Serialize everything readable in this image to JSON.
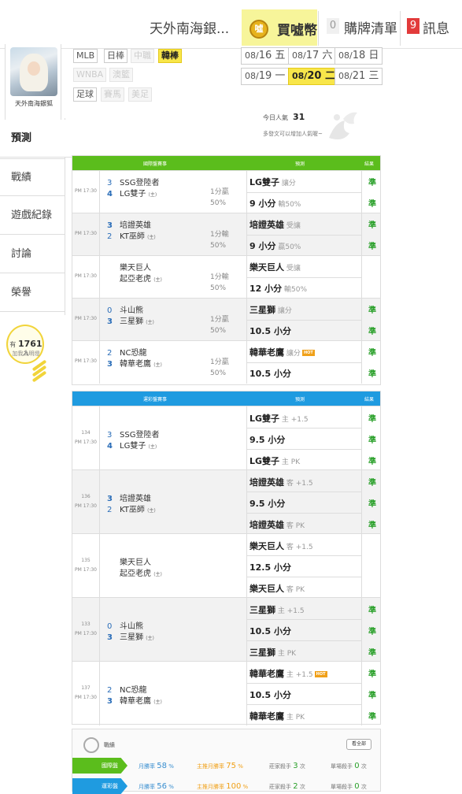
{
  "header": {
    "user_name": "天外南海銀...",
    "coin_label": "買噓幣",
    "cart_count": "0",
    "cart_label": "購牌清單",
    "msg_count": "9",
    "msg_label": "訊息"
  },
  "profile": {
    "name": "天外南海銀狐"
  },
  "sidebar": {
    "items": [
      {
        "label": "預測",
        "active": true
      },
      {
        "label": "戰績"
      },
      {
        "label": "遊戲紀錄"
      },
      {
        "label": "討論"
      },
      {
        "label": "榮譽"
      }
    ],
    "fans_prefix": "有",
    "fans_count": "1761",
    "fans_suffix": "人",
    "fans_sub": "加我為明燈"
  },
  "categories": [
    {
      "label": "MLB",
      "state": "normal"
    },
    {
      "label": "日棒",
      "state": "normal"
    },
    {
      "label": "中職",
      "state": "disabled"
    },
    {
      "label": "韓棒",
      "state": "active"
    },
    {
      "label": "WNBA",
      "state": "disabled"
    },
    {
      "label": "澳籃",
      "state": "disabled"
    },
    {
      "label": "足球",
      "state": "normal"
    },
    {
      "label": "賽馬",
      "state": "disabled"
    },
    {
      "label": "美足",
      "state": "disabled"
    }
  ],
  "dates": [
    {
      "md": "08/",
      "day": "16",
      "wd": "五"
    },
    {
      "md": "08/",
      "day": "17",
      "wd": "六"
    },
    {
      "md": "08/",
      "day": "18",
      "wd": "日"
    },
    {
      "md": "08/",
      "day": "19",
      "wd": "一"
    },
    {
      "md": "08/",
      "day": "20",
      "wd": "二",
      "active": true
    },
    {
      "md": "08/",
      "day": "21",
      "wd": "三"
    }
  ],
  "popularity": {
    "label": "今日人氣",
    "value": "31",
    "tip": "多發文可以增加人氣喔~"
  },
  "intl_table": {
    "headers": {
      "game": "國際盤賽事",
      "pred": "預測",
      "result": "結果"
    },
    "color": "#5bbd1c",
    "games": [
      {
        "time": "PM 17:30",
        "away_score": "3",
        "away": "SSG登陸者",
        "home_score": "4",
        "home": "LG雙子",
        "home_tag": "(主)",
        "handicap": "1分贏",
        "pct": "50%",
        "preds": [
          {
            "text": "LG雙子",
            "note": "讓分",
            "res": "準"
          },
          {
            "text": "9 小分",
            "note": "輸50%",
            "res": "準"
          }
        ]
      },
      {
        "time": "PM 17:30",
        "away_score": "3",
        "away": "培證英雄",
        "home_score": "2",
        "home": "KT巫師",
        "home_tag": "(主)",
        "handicap": "1分輸",
        "pct": "50%",
        "preds": [
          {
            "text": "培證英雄",
            "note": "受讓",
            "res": "準"
          },
          {
            "text": "9 小分",
            "note": "贏50%",
            "res": "準"
          }
        ]
      },
      {
        "time": "PM 17:30",
        "away_score": "",
        "away": "樂天巨人",
        "home_score": "",
        "home": "起亞老虎",
        "home_tag": "(主)",
        "handicap": "1分輸",
        "pct": "50%",
        "preds": [
          {
            "text": "樂天巨人",
            "note": "受讓",
            "res": ""
          },
          {
            "text": "12 小分",
            "note": "輸50%",
            "res": ""
          }
        ]
      },
      {
        "time": "PM 17:30",
        "away_score": "0",
        "away": "斗山熊",
        "home_score": "3",
        "home": "三星獅",
        "home_tag": "(主)",
        "handicap": "1分贏",
        "pct": "50%",
        "preds": [
          {
            "text": "三星獅",
            "note": "讓分",
            "res": "準"
          },
          {
            "text": "10.5 小分",
            "note": "",
            "res": "準"
          }
        ]
      },
      {
        "time": "PM 17:30",
        "away_score": "2",
        "away": "NC恐龍",
        "home_score": "3",
        "home": "韓華老鷹",
        "home_tag": "(主)",
        "handicap": "1分贏",
        "pct": "50%",
        "preds": [
          {
            "text": "韓華老鷹",
            "note": "讓分",
            "tag": "HOT",
            "res": "準"
          },
          {
            "text": "10.5 小分",
            "note": "",
            "res": "準"
          }
        ]
      }
    ]
  },
  "lottery_table": {
    "headers": {
      "game": "運彩盤賽事",
      "pred": "預測",
      "result": "結果"
    },
    "color": "#1f9be0",
    "games": [
      {
        "no": "134",
        "time": "PM 17:30",
        "away_score": "3",
        "away": "SSG登陸者",
        "home_score": "4",
        "home": "LG雙子",
        "home_tag": "(主)",
        "preds": [
          {
            "text": "LG雙子",
            "note": "主 +1.5",
            "res": "準"
          },
          {
            "text": "9.5 小分",
            "note": "",
            "res": "準"
          },
          {
            "text": "LG雙子",
            "note": "主 PK",
            "res": "準"
          }
        ]
      },
      {
        "no": "136",
        "time": "PM 17:30",
        "away_score": "3",
        "away": "培證英雄",
        "home_score": "2",
        "home": "KT巫師",
        "home_tag": "(主)",
        "preds": [
          {
            "text": "培證英雄",
            "note": "客 +1.5",
            "res": "準"
          },
          {
            "text": "9.5 小分",
            "note": "",
            "res": "準"
          },
          {
            "text": "培證英雄",
            "note": "客 PK",
            "res": "準"
          }
        ]
      },
      {
        "no": "135",
        "time": "PM 17:30",
        "away_score": "",
        "away": "樂天巨人",
        "home_score": "",
        "home": "起亞老虎",
        "home_tag": "(主)",
        "preds": [
          {
            "text": "樂天巨人",
            "note": "客 +1.5",
            "res": ""
          },
          {
            "text": "12.5 小分",
            "note": "",
            "res": ""
          },
          {
            "text": "樂天巨人",
            "note": "客 PK",
            "res": ""
          }
        ]
      },
      {
        "no": "133",
        "time": "PM 17:30",
        "away_score": "0",
        "away": "斗山熊",
        "home_score": "3",
        "home": "三星獅",
        "home_tag": "(主)",
        "preds": [
          {
            "text": "三星獅",
            "note": "主 +1.5",
            "res": "準"
          },
          {
            "text": "10.5 小分",
            "note": "",
            "res": "準"
          },
          {
            "text": "三星獅",
            "note": "主 PK",
            "res": "準"
          }
        ]
      },
      {
        "no": "137",
        "time": "PM 17:30",
        "away_score": "2",
        "away": "NC恐龍",
        "home_score": "3",
        "home": "韓華老鷹",
        "home_tag": "(主)",
        "preds": [
          {
            "text": "韓華老鷹",
            "note": "主 +1.5",
            "tag": "HOT",
            "res": "準"
          },
          {
            "text": "10.5 小分",
            "note": "",
            "res": "準"
          },
          {
            "text": "韓華老鷹",
            "note": "主 PK",
            "res": "準"
          }
        ]
      }
    ]
  },
  "record": {
    "title": "戰績",
    "all_label": "看全部",
    "rows": [
      {
        "label": "國際盤",
        "color": "#5bbd1c",
        "month_rate_label": "月勝率",
        "month_rate": "58",
        "main_rate_label": "主推月勝率",
        "main_rate": "75",
        "banker_label": "莊家殺手",
        "banker": "3",
        "single_label": "單場殺手",
        "single": "0",
        "unit": "%",
        "times": "次"
      },
      {
        "label": "運彩盤",
        "color": "#1f9be0",
        "month_rate_label": "月勝率",
        "month_rate": "56",
        "main_rate_label": "主推月勝率",
        "main_rate": "100",
        "banker_label": "莊家殺手",
        "banker": "2",
        "single_label": "單場殺手",
        "single": "0",
        "unit": "%",
        "times": "次"
      }
    ]
  },
  "colors": {
    "accent_yellow": "#f8e64a",
    "win_green": "#2aa02a",
    "intl_green": "#5bbd1c",
    "lottery_blue": "#1f9be0"
  }
}
